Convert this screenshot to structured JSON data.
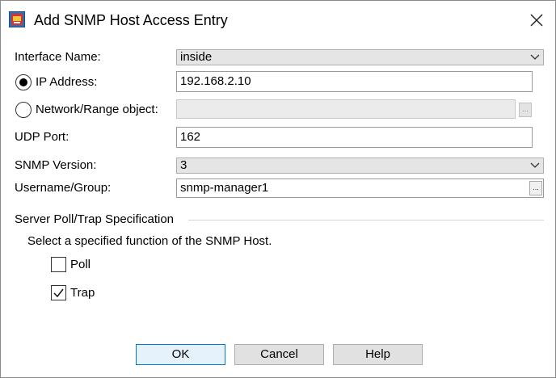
{
  "window": {
    "title": "Add SNMP Host Access Entry"
  },
  "interface": {
    "label": "Interface Name:",
    "value": "inside"
  },
  "ip_address": {
    "label": "IP Address:",
    "value": "192.168.2.10",
    "selected": true
  },
  "network_range": {
    "label": "Network/Range object:",
    "value": "",
    "selected": false,
    "button_label": "..."
  },
  "udp_port": {
    "label": "UDP Port:",
    "value": "162"
  },
  "snmp_version": {
    "label": "SNMP Version:",
    "value": "3"
  },
  "username_group": {
    "label": "Username/Group:",
    "value": "snmp-manager1",
    "button_label": "..."
  },
  "server_spec": {
    "title": "Server Poll/Trap Specification",
    "description": "Select a specified function of the SNMP Host.",
    "poll": {
      "label": "Poll",
      "checked": false
    },
    "trap": {
      "label": "Trap",
      "checked": true
    }
  },
  "buttons": {
    "ok": "OK",
    "cancel": "Cancel",
    "help": "Help"
  },
  "icons": {
    "app": "snmp-app-icon",
    "close": "close-icon",
    "dropdown": "chevron-down-icon",
    "check": "checkmark-icon"
  },
  "colors": {
    "default_button_border": "#0078d7",
    "default_button_bg": "#e5f1fb"
  }
}
